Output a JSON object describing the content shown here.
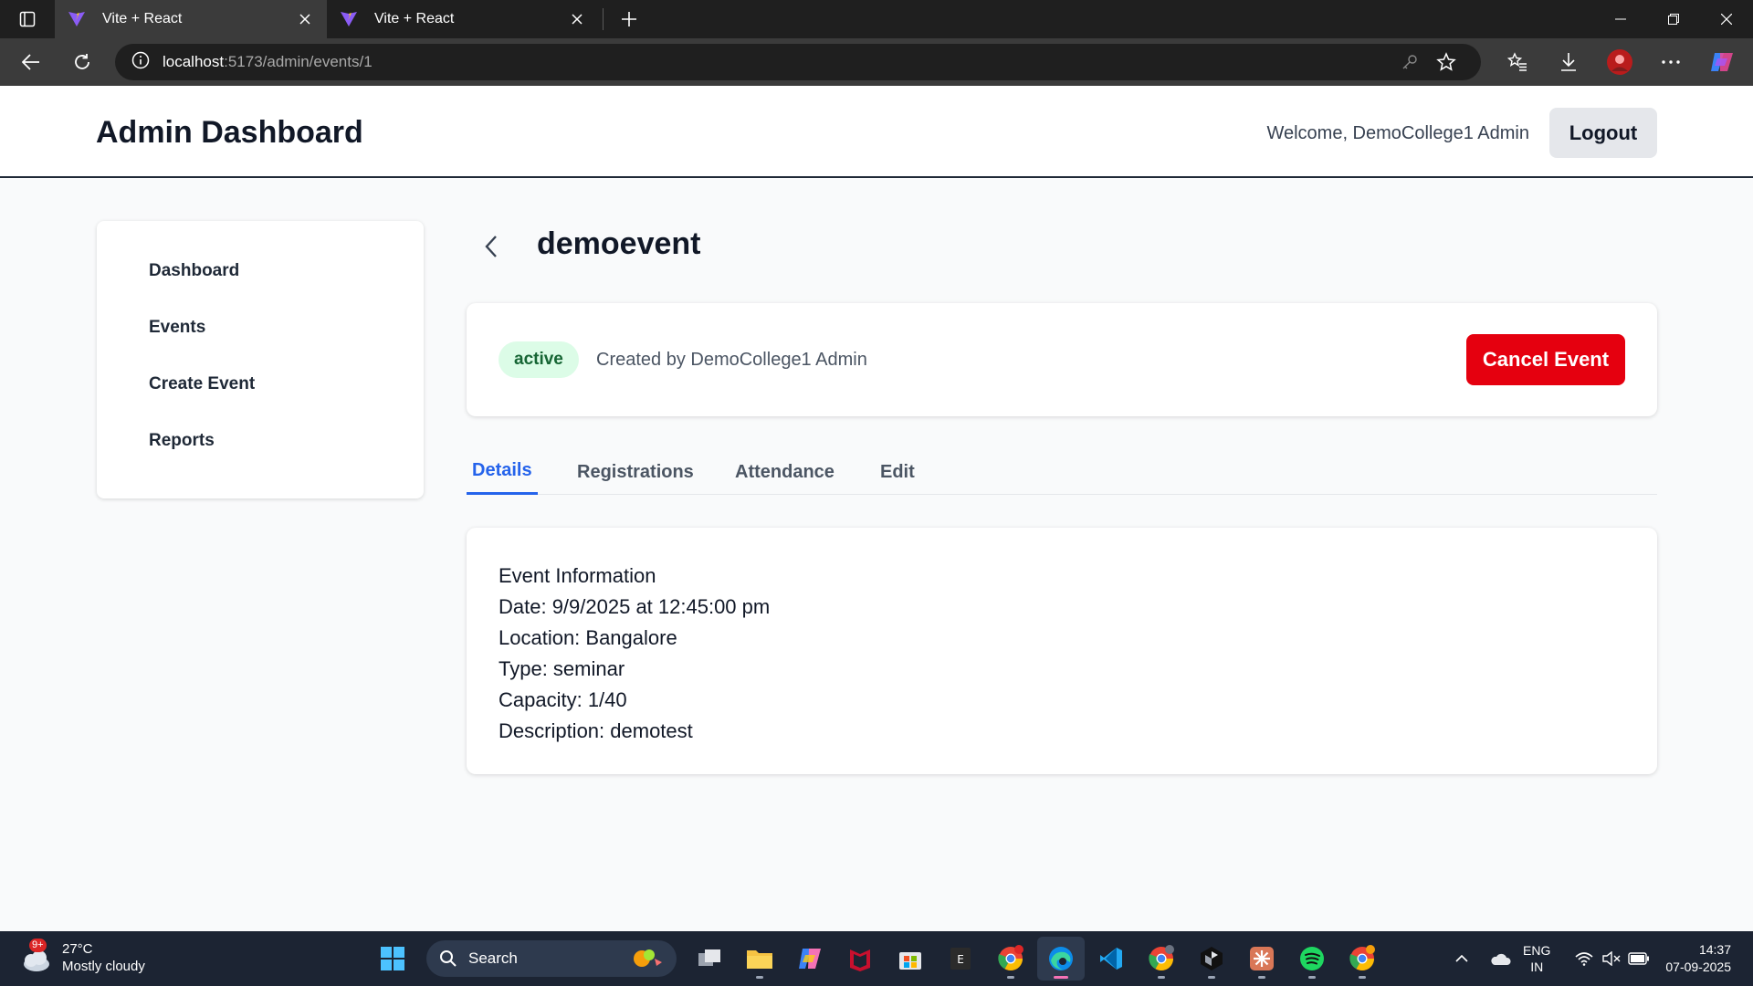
{
  "browser": {
    "tabs": [
      {
        "title": "Vite + React",
        "active": true
      },
      {
        "title": "Vite + React",
        "active": false
      }
    ],
    "url_host": "localhost",
    "url_path": ":5173/admin/events/1"
  },
  "header": {
    "title": "Admin Dashboard",
    "welcome": "Welcome, DemoCollege1 Admin",
    "logout_label": "Logout"
  },
  "sidebar": {
    "items": [
      {
        "label": "Dashboard"
      },
      {
        "label": "Events"
      },
      {
        "label": "Create Event"
      },
      {
        "label": "Reports"
      }
    ]
  },
  "event": {
    "title": "demoevent",
    "status": "active",
    "created_by": "Created by DemoCollege1 Admin",
    "cancel_label": "Cancel Event"
  },
  "tabs": [
    {
      "label": "Details",
      "active": true
    },
    {
      "label": "Registrations",
      "active": false
    },
    {
      "label": "Attendance",
      "active": false
    },
    {
      "label": "Edit",
      "active": false
    }
  ],
  "details": {
    "heading": "Event Information",
    "date": "Date: 9/9/2025 at 12:45:00 pm",
    "location": "Location: Bangalore",
    "type": "Type: seminar",
    "capacity": "Capacity: 1/40",
    "description": "Description: demotest"
  },
  "taskbar": {
    "weather_badge": "9+",
    "temperature": "27°C",
    "condition": "Mostly cloudy",
    "search_placeholder": "Search",
    "lang_line1": "ENG",
    "lang_line2": "IN",
    "time": "14:37",
    "date": "07-09-2025"
  },
  "colors": {
    "accent": "#2563eb",
    "danger": "#e5000f",
    "badge_bg": "#dcfce7",
    "badge_text": "#166534"
  }
}
